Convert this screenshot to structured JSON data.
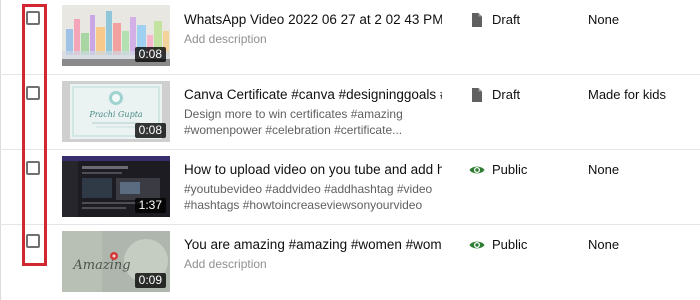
{
  "videos": [
    {
      "title": "WhatsApp Video 2022 06 27 at 2 02 43 PM",
      "description_lines": [
        "Add description"
      ],
      "duration": "0:08",
      "visibility": "Draft",
      "visibility_icon": "draft-file-icon",
      "audience": "None",
      "thumb_label": "cityscape watercolor"
    },
    {
      "title": "Canva Certificate #canva #designinggoals #w...",
      "description_lines": [
        "Design more to win certificates #amazing",
        "#womenpower #celebration #certificate..."
      ],
      "duration": "0:08",
      "visibility": "Draft",
      "visibility_icon": "draft-file-icon",
      "audience": "Made for kids",
      "thumb_label": "Prachi Gupta"
    },
    {
      "title": "How to upload video on you tube and add has...",
      "description_lines": [
        "#youtubevideo #addvideo #addhashtag #video",
        "#hashtags #howtoincreaseviewsonyourvideo"
      ],
      "duration": "1:37",
      "visibility": "Public",
      "visibility_icon": "eye-icon",
      "audience": "None",
      "thumb_label": "screen recording"
    },
    {
      "title": "You are amazing #amazing #women #women...",
      "description_lines": [
        "Add description"
      ],
      "duration": "0:09",
      "visibility": "Public",
      "visibility_icon": "eye-icon",
      "audience": "None",
      "thumb_label": "Amazing"
    }
  ],
  "colors": {
    "public_eye": "#2e7d32",
    "draft_icon": "#606060",
    "highlight_box": "#d22630"
  }
}
